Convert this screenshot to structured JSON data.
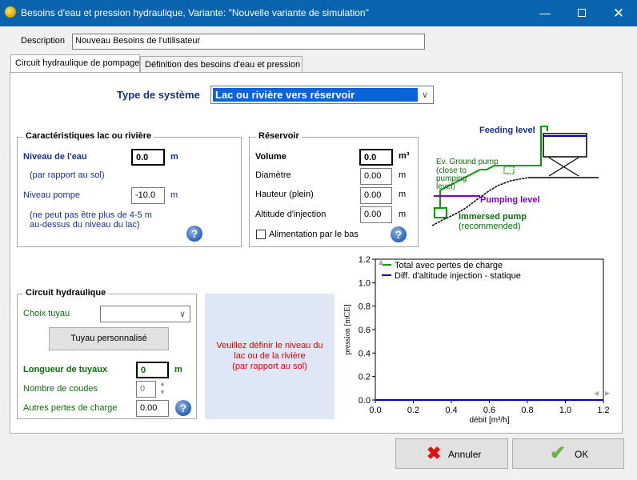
{
  "window": {
    "title": "Besoins d'eau et pression hydraulique, Variante:   \"Nouvelle variante de simulation\""
  },
  "description": {
    "label": "Description",
    "value": "Nouveau Besoins de l'utilisateur"
  },
  "tabs": [
    {
      "label": "Circuit hydraulique de pompage",
      "active": true
    },
    {
      "label": "Définition des besoins d'eau et pression",
      "active": false
    }
  ],
  "system_type": {
    "label": "Type de système",
    "value": "Lac ou rivière vers réservoir"
  },
  "lake": {
    "title": "Caractéristiques lac ou rivière",
    "water_level_label": "Niveau de l'eau",
    "water_level_value": "0.0",
    "water_level_unit": "m",
    "ground_note": "(par rapport au sol)",
    "pump_level_label": "Niveau pompe",
    "pump_level_value": "-10.0",
    "pump_level_unit": "m",
    "note_line1": "(ne peut pas être plus de 4-5 m",
    "note_line2": "au-dessus du niveau du lac)"
  },
  "reservoir": {
    "title": "Réservoir",
    "volume_label": "Volume",
    "volume_value": "0.0",
    "volume_unit": "m³",
    "diameter_label": "Diamètre",
    "diameter_value": "0.00",
    "diameter_unit": "m",
    "height_label": "Hauteur (plein)",
    "height_value": "0.00",
    "height_unit": "m",
    "altitude_label": "Altitude d'injection",
    "altitude_value": "0.00",
    "altitude_unit": "m",
    "bottom_feed_label": "Alimentation par le bas"
  },
  "diagram": {
    "feeding_level": "Feeding level",
    "ground_pump_line1": "Ev. Ground pump",
    "ground_pump_line2": "(close to",
    "ground_pump_line3": "pumping",
    "ground_pump_line4": "level)",
    "pumping_level": "Pumping level",
    "immersed_pump": "Immersed pump",
    "recommended": "(recommended)"
  },
  "circuit": {
    "title": "Circuit hydraulique",
    "pipe_choice_label": "Choix tuyau",
    "pipe_choice_value": "",
    "custom_pipe_button": "Tuyau personnalisé",
    "pipe_length_label": "Longueur de tuyaux",
    "pipe_length_value": "0",
    "pipe_length_unit": "m",
    "elbows_label": "Nombre de coudes",
    "elbows_value": "0",
    "other_losses_label": "Autres pertes de charge",
    "other_losses_value": "0.00"
  },
  "message": "Veuillez définir le niveau du lac ou de la rivière\n(par rapport au sol)",
  "chart_data": {
    "type": "line",
    "xlabel": "débit [m³/h]",
    "ylabel": "pression [mCE]",
    "xlim": [
      0,
      1.2
    ],
    "ylim": [
      0,
      1.2
    ],
    "xticks": [
      "0.0",
      "0.2",
      "0.4",
      "0.6",
      "0.8",
      "1.0",
      "1.2"
    ],
    "yticks": [
      "0.0",
      "0.2",
      "0.4",
      "0.6",
      "0.8",
      "1.0",
      "1.2"
    ],
    "legend_position": "top-left",
    "series": [
      {
        "name": "Total avec pertes de charge",
        "color": "#00a000",
        "x": [
          0,
          1.2
        ],
        "y": [
          0,
          0
        ]
      },
      {
        "name": "Diff. d'altitude injection - statique",
        "color": "#0000c8",
        "x": [
          0,
          1.2
        ],
        "y": [
          0,
          0
        ]
      }
    ]
  },
  "buttons": {
    "cancel": "Annuler",
    "ok": "OK"
  }
}
